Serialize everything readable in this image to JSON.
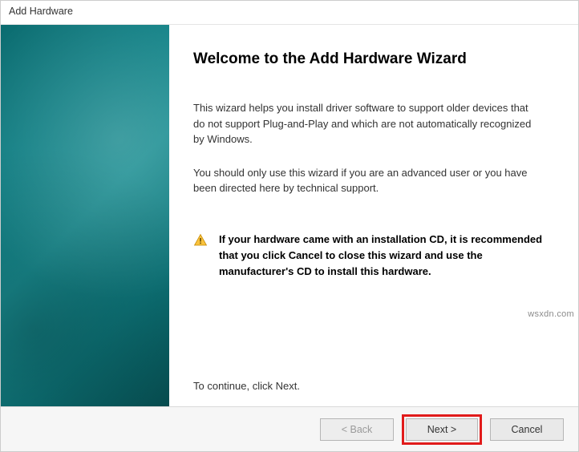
{
  "window": {
    "title": "Add Hardware"
  },
  "content": {
    "heading": "Welcome to the Add Hardware Wizard",
    "para1": "This wizard helps you install driver software to support older devices that do not support Plug-and-Play and which are not automatically recognized by Windows.",
    "para2": "You should only use this wizard if you are an advanced user or you have been directed here by technical support.",
    "warning": "If your hardware came with an installation CD, it is recommended that you click Cancel to close this wizard and use the manufacturer's CD to install this hardware.",
    "continue": "To continue, click Next."
  },
  "buttons": {
    "back": "< Back",
    "next": "Next >",
    "cancel": "Cancel"
  },
  "watermark": "wsxdn.com"
}
